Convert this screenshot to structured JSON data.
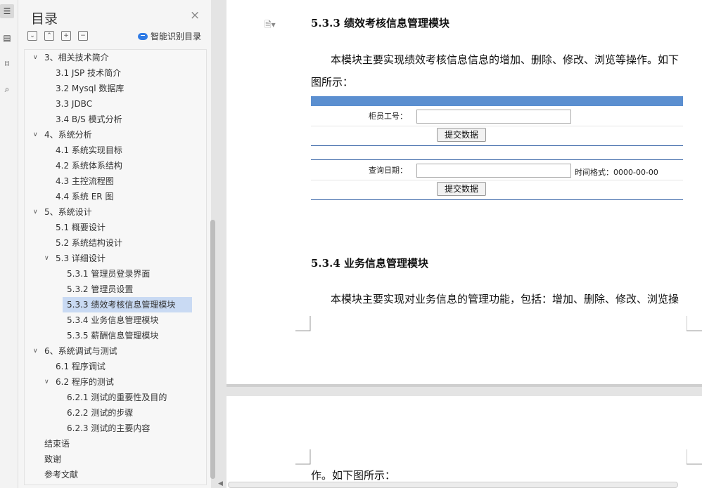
{
  "toc": {
    "title": "目录",
    "ai_label": "智能识别目录",
    "items": [
      {
        "label": "3、相关技术简介",
        "level": 1,
        "expanded": true
      },
      {
        "label": "3.1 JSP 技术简介",
        "level": 2
      },
      {
        "label": "3.2 Mysql 数据库",
        "level": 2
      },
      {
        "label": "3.3 JDBC",
        "level": 2
      },
      {
        "label": "3.4 B/S 模式分析",
        "level": 2
      },
      {
        "label": "4、系统分析",
        "level": 1,
        "expanded": true
      },
      {
        "label": "4.1  系统实现目标",
        "level": 2
      },
      {
        "label": "4.2  系统体系结构",
        "level": 2
      },
      {
        "label": "4.3  主控流程图",
        "level": 2
      },
      {
        "label": "4.4  系统 ER 图",
        "level": 2
      },
      {
        "label": "5、系统设计",
        "level": 1,
        "expanded": true
      },
      {
        "label": "5.1  概要设计",
        "level": 2
      },
      {
        "label": "5.2  系统结构设计",
        "level": 2
      },
      {
        "label": "5.3  详细设计",
        "level": 2,
        "expanded": true
      },
      {
        "label": "5.3.1  管理员登录界面",
        "level": 3
      },
      {
        "label": "5.3.2  管理员设置",
        "level": 3
      },
      {
        "label": "5.3.3  绩效考核信息管理模块",
        "level": 3,
        "selected": true
      },
      {
        "label": "5.3.4  业务信息管理模块",
        "level": 3
      },
      {
        "label": "5.3.5  薪酬信息管理模块",
        "level": 3
      },
      {
        "label": "6、系统调试与测试",
        "level": 1,
        "expanded": true
      },
      {
        "label": "6.1  程序调试",
        "level": 2
      },
      {
        "label": "6.2  程序的测试",
        "level": 2,
        "expanded": true
      },
      {
        "label": "6.2.1  测试的重要性及目的",
        "level": 3
      },
      {
        "label": "6.2.2  测试的步骤",
        "level": 3
      },
      {
        "label": "6.2.3  测试的主要内容",
        "level": 3
      },
      {
        "label": "结束语",
        "level": 0
      },
      {
        "label": "致谢",
        "level": 0
      },
      {
        "label": "参考文献",
        "level": 0
      }
    ]
  },
  "doc": {
    "heading1": "5.3.3  绩效考核信息管理模块",
    "para1_line1": "本模块主要实现绩效考核信息信息的增加、删除、修改、浏览等操作。如下",
    "para1_line2": "图所示：",
    "figure": {
      "label_staff_id": "柜员工号：",
      "submit1": "提交数据",
      "label_query_date": "查询日期：",
      "date_hint": "时间格式：0000-00-00",
      "submit2": "提交数据"
    },
    "heading2": "5.3.4  业务信息管理模块",
    "para2_line1": "本模块主要实现对业务信息的管理功能，包括：增加、删除、修改、浏览操",
    "para2_cont": "作。如下图所示："
  }
}
